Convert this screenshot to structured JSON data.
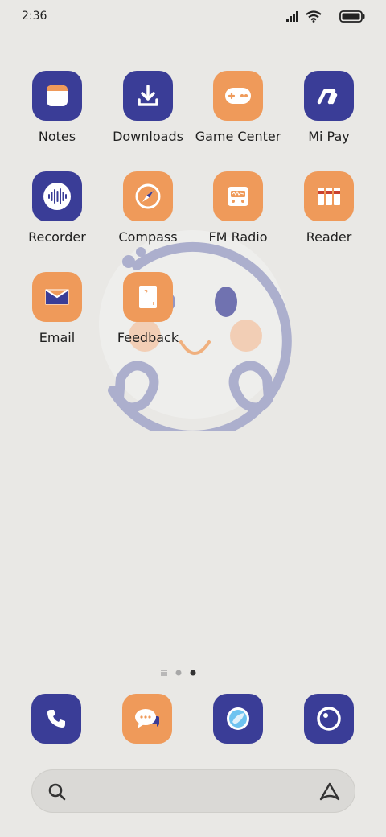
{
  "status_bar": {
    "time": "2:36",
    "icons": [
      "signal-icon",
      "wifi-icon",
      "battery-icon"
    ]
  },
  "home": {
    "apps": [
      {
        "label": "Notes",
        "color": "#3a3d97",
        "icon": "notes-icon"
      },
      {
        "label": "Downloads",
        "color": "#3a3d97",
        "icon": "download-icon"
      },
      {
        "label": "Game Center",
        "color": "#ef9a5a",
        "icon": "gamepad-icon"
      },
      {
        "label": "Mi Pay",
        "color": "#3a3d97",
        "icon": "mi-pay-icon"
      },
      {
        "label": "Recorder",
        "color": "#3a3d97",
        "icon": "waveform-icon"
      },
      {
        "label": "Compass",
        "color": "#ef9a5a",
        "icon": "compass-icon"
      },
      {
        "label": "FM Radio",
        "color": "#ef9a5a",
        "icon": "radio-icon"
      },
      {
        "label": "Reader",
        "color": "#ef9a5a",
        "icon": "books-icon"
      },
      {
        "label": "Email",
        "color": "#ef9a5a",
        "icon": "envelope-icon"
      },
      {
        "label": "Feedback",
        "color": "#ef9a5a",
        "icon": "feedback-icon"
      }
    ]
  },
  "pager": {
    "pages": 3,
    "current": 2
  },
  "dock": [
    {
      "name": "phone",
      "color": "#3a3d97",
      "icon": "phone-icon"
    },
    {
      "name": "messages",
      "color": "#ef9a5a",
      "icon": "message-bubble-icon"
    },
    {
      "name": "browser",
      "color": "#3a3d97",
      "icon": "browser-icon"
    },
    {
      "name": "camera",
      "color": "#3a3d97",
      "icon": "camera-icon"
    }
  ],
  "search": {
    "icon": "search-icon",
    "trailing_icon": "assistant-icon"
  }
}
